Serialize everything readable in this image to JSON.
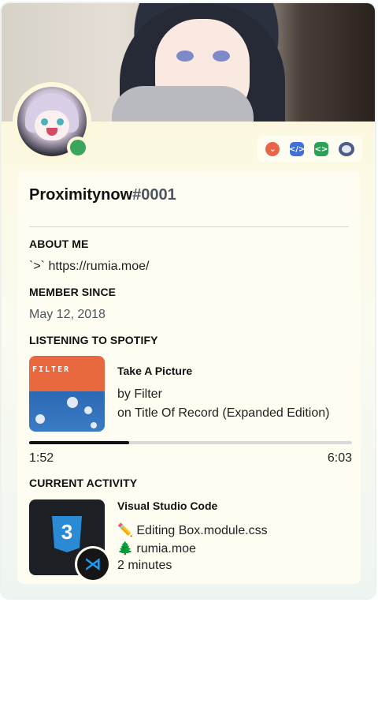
{
  "profile": {
    "username": "Proximitynow",
    "discriminator": "#0001",
    "status": "online",
    "status_color": "#3ba55d",
    "badge_icons": [
      "chevron-badge-icon",
      "code-badge-icon",
      "brackets-badge-icon",
      "nitro-badge-icon"
    ]
  },
  "about": {
    "heading": "ABOUT ME",
    "text": "`>` https://rumia.moe/"
  },
  "member": {
    "heading": "MEMBER SINCE",
    "date": "May 12, 2018"
  },
  "spotify": {
    "heading": "LISTENING TO SPOTIFY",
    "album_art_text": "FILTER",
    "song": "Take A Picture",
    "artist": "by Filter",
    "album": "on Title Of Record (Expanded Edition)",
    "elapsed": "1:52",
    "duration": "6:03",
    "progress": 0.31
  },
  "activity": {
    "heading": "CURRENT ACTIVITY",
    "app": "Visual Studio Code",
    "details": "✏️ Editing Box.module.css",
    "state": "🌲 rumia.moe",
    "elapsed": "2 minutes",
    "large_icon": "css3-icon",
    "small_icon": "vscode-icon",
    "css3_label": "3"
  }
}
